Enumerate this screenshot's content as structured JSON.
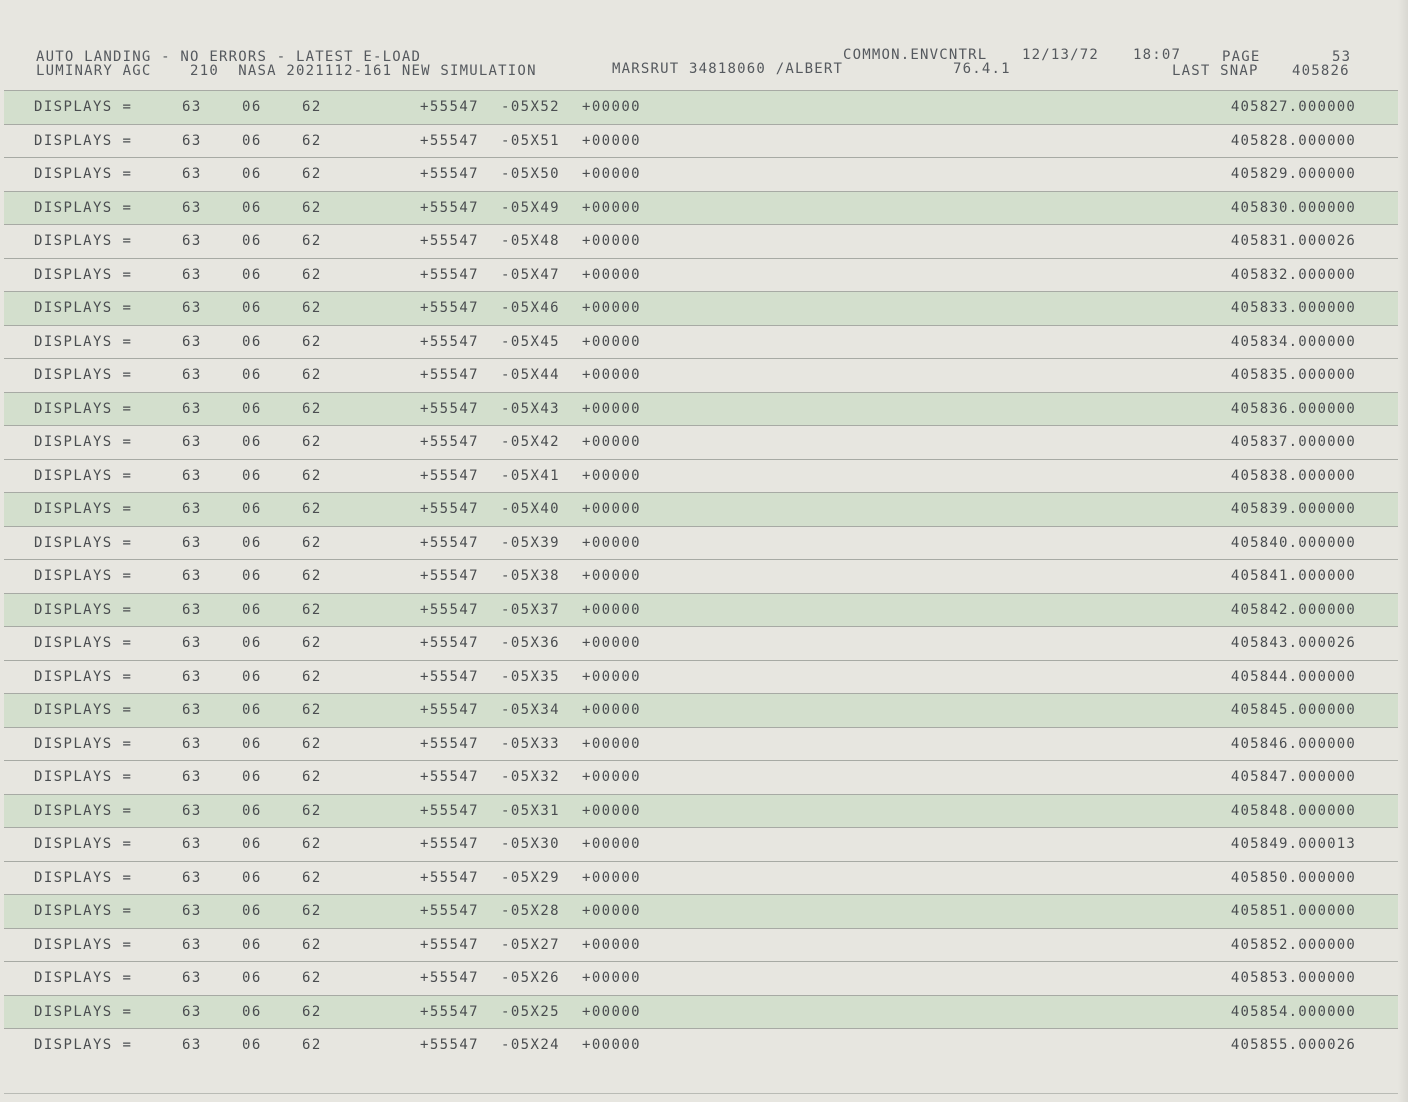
{
  "header": {
    "line1_left": "AUTO LANDING - NO ERRORS - LATEST E-LOAD",
    "line1_center": "COMMON.ENVCNTRL",
    "line1_date": "12/13/72",
    "line1_time": "18:07",
    "line1_page_label": "PAGE",
    "line1_page_num": "53",
    "line2_left": "LUMINARY AGC    210  NASA 2021112-161 NEW SIMULATION",
    "line2_center": "MARSRUT 34818060 /ALBERT",
    "line2_version": "76.4.1",
    "line2_snap_label": "LAST SNAP",
    "line2_snap_num": "405826"
  },
  "rows": [
    {
      "label": "DISPLAYS =",
      "c1": "63",
      "c2": "06",
      "c3": "62",
      "c4": "+55547",
      "c5": "-05X52",
      "c6": "+00000",
      "time": "405827.000000"
    },
    {
      "label": "DISPLAYS =",
      "c1": "63",
      "c2": "06",
      "c3": "62",
      "c4": "+55547",
      "c5": "-05X51",
      "c6": "+00000",
      "time": "405828.000000"
    },
    {
      "label": "DISPLAYS =",
      "c1": "63",
      "c2": "06",
      "c3": "62",
      "c4": "+55547",
      "c5": "-05X50",
      "c6": "+00000",
      "time": "405829.000000"
    },
    {
      "label": "DISPLAYS =",
      "c1": "63",
      "c2": "06",
      "c3": "62",
      "c4": "+55547",
      "c5": "-05X49",
      "c6": "+00000",
      "time": "405830.000000"
    },
    {
      "label": "DISPLAYS =",
      "c1": "63",
      "c2": "06",
      "c3": "62",
      "c4": "+55547",
      "c5": "-05X48",
      "c6": "+00000",
      "time": "405831.000026"
    },
    {
      "label": "DISPLAYS =",
      "c1": "63",
      "c2": "06",
      "c3": "62",
      "c4": "+55547",
      "c5": "-05X47",
      "c6": "+00000",
      "time": "405832.000000"
    },
    {
      "label": "DISPLAYS =",
      "c1": "63",
      "c2": "06",
      "c3": "62",
      "c4": "+55547",
      "c5": "-05X46",
      "c6": "+00000",
      "time": "405833.000000"
    },
    {
      "label": "DISPLAYS =",
      "c1": "63",
      "c2": "06",
      "c3": "62",
      "c4": "+55547",
      "c5": "-05X45",
      "c6": "+00000",
      "time": "405834.000000"
    },
    {
      "label": "DISPLAYS =",
      "c1": "63",
      "c2": "06",
      "c3": "62",
      "c4": "+55547",
      "c5": "-05X44",
      "c6": "+00000",
      "time": "405835.000000"
    },
    {
      "label": "DISPLAYS =",
      "c1": "63",
      "c2": "06",
      "c3": "62",
      "c4": "+55547",
      "c5": "-05X43",
      "c6": "+00000",
      "time": "405836.000000"
    },
    {
      "label": "DISPLAYS =",
      "c1": "63",
      "c2": "06",
      "c3": "62",
      "c4": "+55547",
      "c5": "-05X42",
      "c6": "+00000",
      "time": "405837.000000"
    },
    {
      "label": "DISPLAYS =",
      "c1": "63",
      "c2": "06",
      "c3": "62",
      "c4": "+55547",
      "c5": "-05X41",
      "c6": "+00000",
      "time": "405838.000000"
    },
    {
      "label": "DISPLAYS =",
      "c1": "63",
      "c2": "06",
      "c3": "62",
      "c4": "+55547",
      "c5": "-05X40",
      "c6": "+00000",
      "time": "405839.000000"
    },
    {
      "label": "DISPLAYS =",
      "c1": "63",
      "c2": "06",
      "c3": "62",
      "c4": "+55547",
      "c5": "-05X39",
      "c6": "+00000",
      "time": "405840.000000"
    },
    {
      "label": "DISPLAYS =",
      "c1": "63",
      "c2": "06",
      "c3": "62",
      "c4": "+55547",
      "c5": "-05X38",
      "c6": "+00000",
      "time": "405841.000000"
    },
    {
      "label": "DISPLAYS =",
      "c1": "63",
      "c2": "06",
      "c3": "62",
      "c4": "+55547",
      "c5": "-05X37",
      "c6": "+00000",
      "time": "405842.000000"
    },
    {
      "label": "DISPLAYS =",
      "c1": "63",
      "c2": "06",
      "c3": "62",
      "c4": "+55547",
      "c5": "-05X36",
      "c6": "+00000",
      "time": "405843.000026"
    },
    {
      "label": "DISPLAYS =",
      "c1": "63",
      "c2": "06",
      "c3": "62",
      "c4": "+55547",
      "c5": "-05X35",
      "c6": "+00000",
      "time": "405844.000000"
    },
    {
      "label": "DISPLAYS =",
      "c1": "63",
      "c2": "06",
      "c3": "62",
      "c4": "+55547",
      "c5": "-05X34",
      "c6": "+00000",
      "time": "405845.000000"
    },
    {
      "label": "DISPLAYS =",
      "c1": "63",
      "c2": "06",
      "c3": "62",
      "c4": "+55547",
      "c5": "-05X33",
      "c6": "+00000",
      "time": "405846.000000"
    },
    {
      "label": "DISPLAYS =",
      "c1": "63",
      "c2": "06",
      "c3": "62",
      "c4": "+55547",
      "c5": "-05X32",
      "c6": "+00000",
      "time": "405847.000000"
    },
    {
      "label": "DISPLAYS =",
      "c1": "63",
      "c2": "06",
      "c3": "62",
      "c4": "+55547",
      "c5": "-05X31",
      "c6": "+00000",
      "time": "405848.000000"
    },
    {
      "label": "DISPLAYS =",
      "c1": "63",
      "c2": "06",
      "c3": "62",
      "c4": "+55547",
      "c5": "-05X30",
      "c6": "+00000",
      "time": "405849.000013"
    },
    {
      "label": "DISPLAYS =",
      "c1": "63",
      "c2": "06",
      "c3": "62",
      "c4": "+55547",
      "c5": "-05X29",
      "c6": "+00000",
      "time": "405850.000000"
    },
    {
      "label": "DISPLAYS =",
      "c1": "63",
      "c2": "06",
      "c3": "62",
      "c4": "+55547",
      "c5": "-05X28",
      "c6": "+00000",
      "time": "405851.000000"
    },
    {
      "label": "DISPLAYS =",
      "c1": "63",
      "c2": "06",
      "c3": "62",
      "c4": "+55547",
      "c5": "-05X27",
      "c6": "+00000",
      "time": "405852.000000"
    },
    {
      "label": "DISPLAYS =",
      "c1": "63",
      "c2": "06",
      "c3": "62",
      "c4": "+55547",
      "c5": "-05X26",
      "c6": "+00000",
      "time": "405853.000000"
    },
    {
      "label": "DISPLAYS =",
      "c1": "63",
      "c2": "06",
      "c3": "62",
      "c4": "+55547",
      "c5": "-05X25",
      "c6": "+00000",
      "time": "405854.000000"
    },
    {
      "label": "DISPLAYS =",
      "c1": "63",
      "c2": "06",
      "c3": "62",
      "c4": "+55547",
      "c5": "-05X24",
      "c6": "+00000",
      "time": "405855.000026"
    }
  ],
  "colors": {
    "paper": "#e7e6e0",
    "green_band": "#d3dfcd",
    "ink": "#4a4d50",
    "rule": "#a7aaa4"
  }
}
